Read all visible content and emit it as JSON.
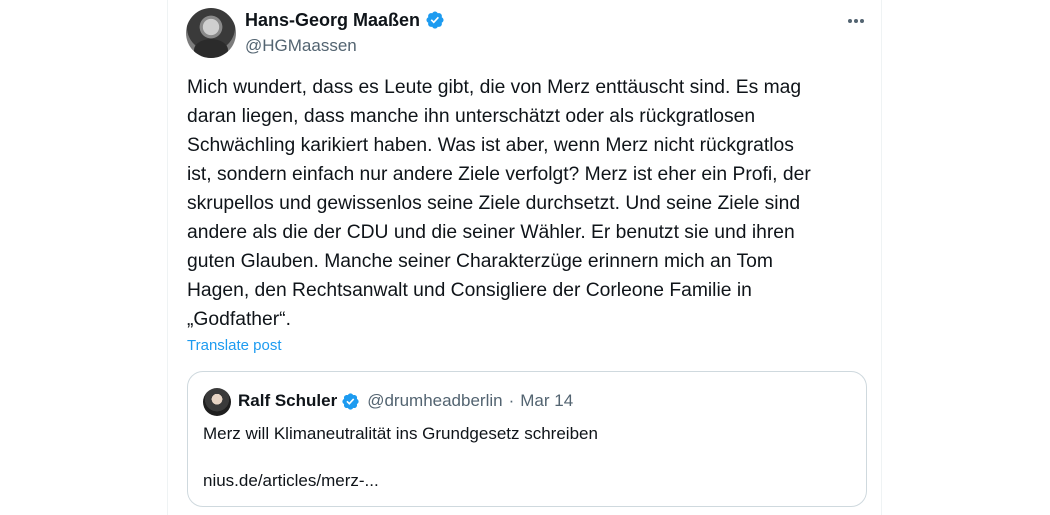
{
  "author": {
    "display_name": "Hans-Georg Maaßen",
    "handle": "@HGMaassen",
    "verified": true,
    "avatar_icon": "portrait-avatar"
  },
  "tweet": {
    "text": "Mich wundert, dass es Leute gibt, die von Merz enttäuscht sind. Es mag\ndaran liegen, dass manche ihn unterschätzt oder als rückgratlosen\nSchwächling karikiert haben. Was ist aber, wenn Merz nicht rückgratlos\nist, sondern einfach nur andere Ziele verfolgt? Merz ist eher ein Profi, der\nskrupellos und gewissenlos seine Ziele durchsetzt. Und seine Ziele sind\nandere als die der CDU und die seiner Wähler. Er benutzt sie und ihren\nguten Glauben. Manche seiner Charakterzüge erinnern mich an Tom\nHagen, den Rechtsanwalt und Consigliere der Corleone Familie in\n„Godfather“.",
    "translate_label": "Translate post"
  },
  "quote": {
    "display_name": "Ralf Schuler",
    "verified": true,
    "handle": "@drumheadberlin",
    "separator": "·",
    "date": "Mar 14",
    "text": "Merz will Klimaneutralität ins Grundgesetz schreiben",
    "link_text": "nius.de/articles/merz-..."
  },
  "colors": {
    "verified_blue": "#1d9bf0",
    "link_blue": "#1d9bf0",
    "secondary_text": "#536471",
    "primary_text": "#0f1419",
    "border": "#cfd9de"
  }
}
